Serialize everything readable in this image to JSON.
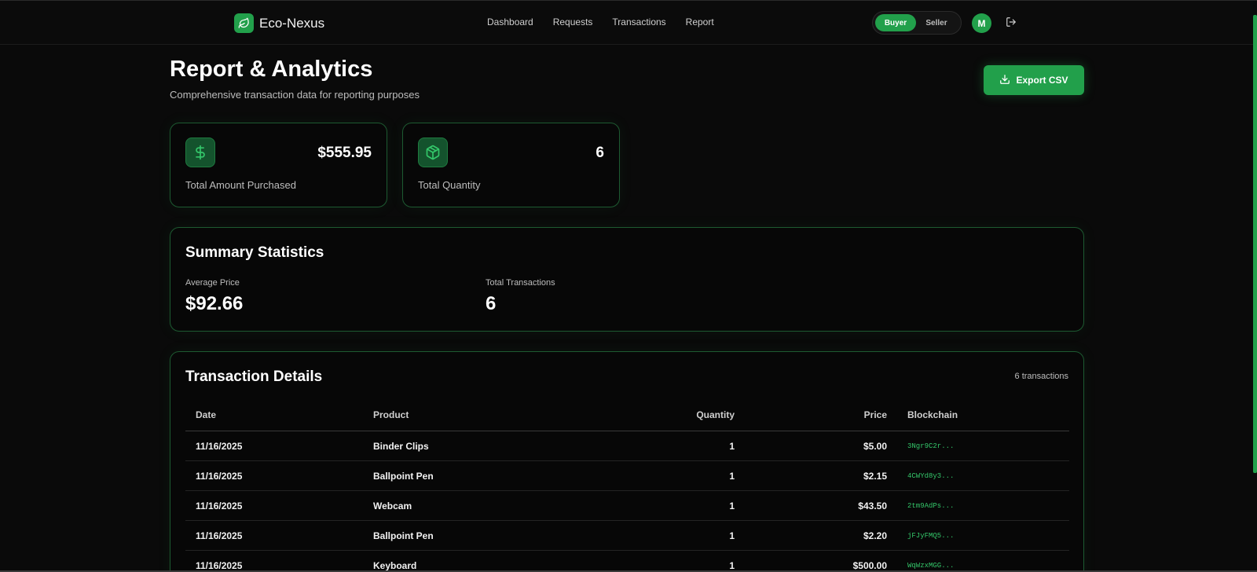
{
  "brand": {
    "name": "Eco-Nexus",
    "accent": "#22a04b"
  },
  "nav": {
    "links": [
      "Dashboard",
      "Requests",
      "Transactions",
      "Report"
    ]
  },
  "role_toggle": {
    "buyer": "Buyer",
    "seller": "Seller",
    "active": "Buyer"
  },
  "user": {
    "initial": "M"
  },
  "header": {
    "title": "Report & Analytics",
    "subtitle": "Comprehensive transaction data for reporting purposes",
    "export_label": "Export CSV"
  },
  "stats": [
    {
      "icon": "dollar-icon",
      "value": "$555.95",
      "label": "Total Amount Purchased"
    },
    {
      "icon": "package-icon",
      "value": "6",
      "label": "Total Quantity"
    }
  ],
  "summary": {
    "title": "Summary Statistics",
    "avg_price_label": "Average Price",
    "avg_price_value": "$92.66",
    "total_tx_label": "Total Transactions",
    "total_tx_value": "6"
  },
  "details": {
    "title": "Transaction Details",
    "count_text": "6 transactions",
    "columns": [
      "Date",
      "Product",
      "Quantity",
      "Price",
      "Blockchain"
    ],
    "rows": [
      {
        "date": "11/16/2025",
        "product": "Binder Clips",
        "quantity": "1",
        "price": "$5.00",
        "chain": "3Ngr9C2r..."
      },
      {
        "date": "11/16/2025",
        "product": "Ballpoint Pen",
        "quantity": "1",
        "price": "$2.15",
        "chain": "4CWYd8y3..."
      },
      {
        "date": "11/16/2025",
        "product": "Webcam",
        "quantity": "1",
        "price": "$43.50",
        "chain": "2tm9AdPs..."
      },
      {
        "date": "11/16/2025",
        "product": "Ballpoint Pen",
        "quantity": "1",
        "price": "$2.20",
        "chain": "jFJyFMQ5..."
      },
      {
        "date": "11/16/2025",
        "product": "Keyboard",
        "quantity": "1",
        "price": "$500.00",
        "chain": "WqWzxMGG..."
      }
    ]
  }
}
